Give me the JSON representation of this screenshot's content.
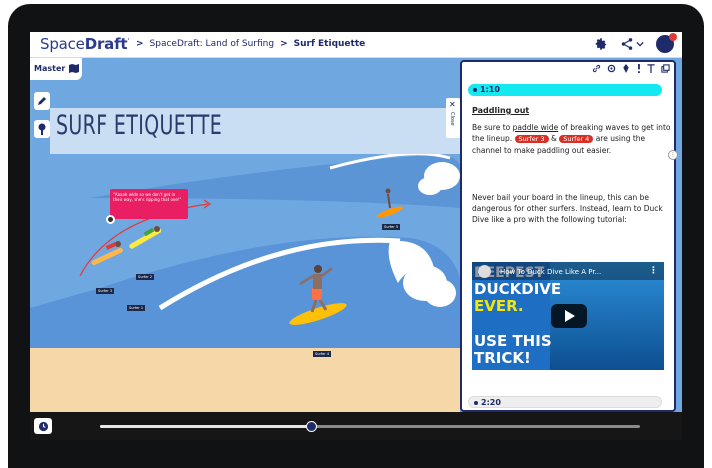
{
  "app": {
    "logo_light": "Space",
    "logo_bold": "Draft",
    "logo_mark": "'"
  },
  "breadcrumb": {
    "sep": ">",
    "items": [
      "SpaceDraft: Land of Surfing",
      "Surf Etiquette"
    ]
  },
  "header_icons": [
    "gear-icon",
    "share-icon",
    "chevron-down-icon",
    "user-avatar"
  ],
  "canvas": {
    "master_label": "Master",
    "title": "SURF ETIQUETTE",
    "callout_text": "\"Aaaah wide so we don't get in their way, she's ripping that one!\"",
    "surfer_tags": [
      "Surfer 1",
      "Surfer 2",
      "Surfer 3",
      "Surfer 4",
      "Surfer 5"
    ],
    "close_label": "Close",
    "colors": {
      "sky": "#6fa7e0",
      "sand": "#f6d8a8",
      "wave": "#ffffff",
      "callout": "#e91e63"
    }
  },
  "panel": {
    "toolbar_icons": [
      "link-icon",
      "settings-icon",
      "pin-icon",
      "flag-icon",
      "text-icon",
      "copy-icon"
    ],
    "timestamp_active": "1:10",
    "section_title": "Paddling out",
    "para1_a": "Be sure to ",
    "para1_link": "paddle wide",
    "para1_b": " of breaking waves to get into the lineup. ",
    "chip1": "Surfer 3",
    "para1_c": " & ",
    "chip2": "Surfer 4",
    "para1_d": " are using the channel  to make paddling out easier.",
    "para2": "Never bail your board in the lineup, this can be dangerous for other surfers. Instead, learn to Duck Dive like a pro with the following tutorial:",
    "video": {
      "title": "How To Duck Dive Like A Pr...",
      "line1": "DEEPEST",
      "line2": "DUCKDIVE",
      "line3": "EVER.",
      "line4": "USE THIS",
      "line5": "TRICK!"
    },
    "timestamp_next": "2:20",
    "accent": "#14e9f2"
  },
  "timeline": {
    "progress": 0.39
  }
}
